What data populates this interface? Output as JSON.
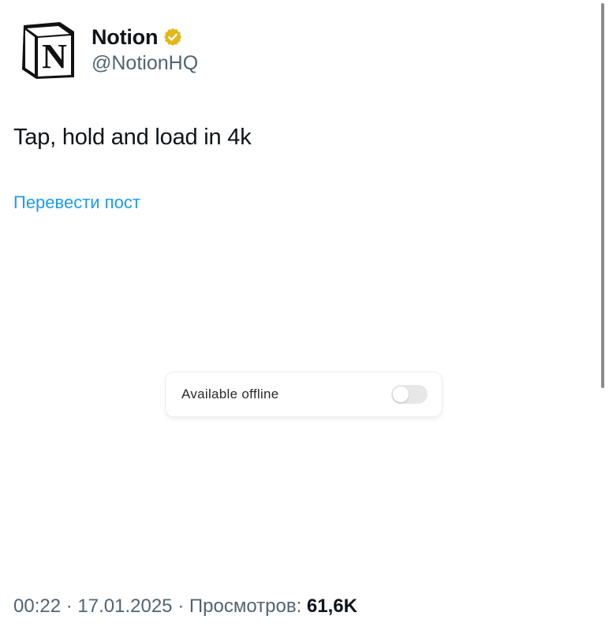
{
  "author": {
    "display_name": "Notion",
    "handle": "@NotionHQ",
    "avatar_icon": "notion-logo-icon",
    "verified_icon": "verified-badge-icon",
    "verified_color": "#E2B719"
  },
  "post": {
    "text": "Tap, hold and load in 4k",
    "translate_label": "Перевести пост"
  },
  "media": {
    "label": "Available offline",
    "toggle_on": false
  },
  "meta": {
    "time": "00:22",
    "separator": "·",
    "date": "17.01.2025",
    "views_label": "Просмотров:",
    "views_count": "61,6K"
  },
  "colors": {
    "link": "#1D9BF0",
    "secondary_text": "#536471",
    "primary_text": "#0F1419"
  }
}
